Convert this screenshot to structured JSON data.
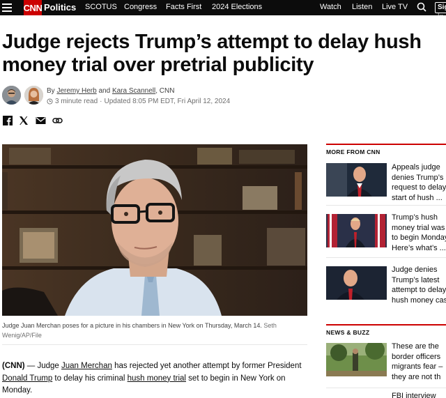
{
  "nav": {
    "logo": "CNN",
    "section": "Politics",
    "links": [
      "SCOTUS",
      "Congress",
      "Facts First",
      "2024 Elections"
    ],
    "right_links": [
      "Watch",
      "Listen",
      "Live TV"
    ],
    "sign_in": "Sign in"
  },
  "article": {
    "headline": "Judge rejects Trump’s attempt to delay hush money trial over pretrial publicity",
    "byline_prefix": "By ",
    "author1": "Jeremy Herb",
    "byline_and": " and ",
    "author2": "Kara Scannell",
    "byline_suffix": ", CNN",
    "read_time": "3 minute read",
    "updated": "Updated 8:05 PM EDT, Fri April 12, 2024",
    "caption": "Judge Juan Merchan poses for a picture in his chambers in New York on Thursday, March 14.",
    "credit": "Seth Wenig/AP/File",
    "body": {
      "source": "(CNN)",
      "dash": " — Judge ",
      "link1": "Juan Merchan",
      "t1": " has rejected yet another attempt by former President ",
      "link2": "Donald Trump",
      "t2": " to delay his criminal ",
      "link3": "hush money trial",
      "t3": " set to begin in New York on Monday."
    }
  },
  "sidebar": {
    "more_heading": "MORE FROM CNN",
    "more_items": [
      {
        "lines": [
          "Appeals judge",
          "denies Trump’s",
          "request to delay",
          "start of hush ..."
        ]
      },
      {
        "lines": [
          "Trump’s hush",
          "money trial was",
          "to begin Monday",
          "Here’s what’s ..."
        ]
      },
      {
        "lines": [
          "Judge denies",
          "Trump’s latest",
          "attempt to delay",
          "hush money case"
        ]
      }
    ],
    "news_heading": "NEWS & BUZZ",
    "news_items": [
      {
        "lines": [
          "These are the",
          "border officers",
          "migrants fear –",
          "they are not th"
        ]
      },
      {
        "lines": [
          "FBI interview"
        ]
      }
    ]
  },
  "colors": {
    "brand_red": "#cc0000",
    "nav_bg": "#0c0c0c"
  }
}
